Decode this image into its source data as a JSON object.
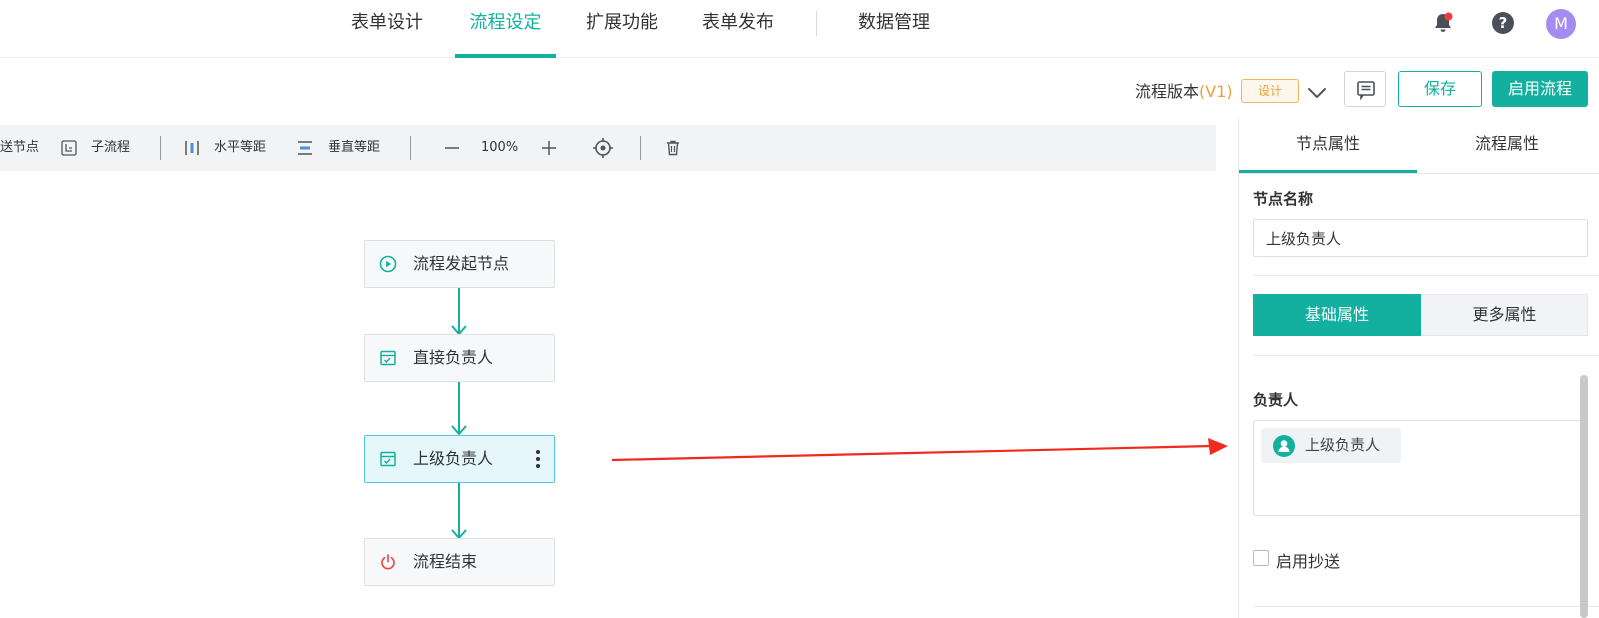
{
  "top_nav": {
    "tabs": [
      {
        "label": "表单设计"
      },
      {
        "label": "流程设定",
        "active": true
      },
      {
        "label": "扩展功能"
      },
      {
        "label": "表单发布"
      },
      {
        "label": "数据管理"
      }
    ],
    "icons": [
      "bell-icon",
      "help-icon"
    ],
    "avatar_letter": "M"
  },
  "version_bar": {
    "label": "流程版本",
    "version": "(V1)",
    "status_badge": "设计",
    "save_label": "保存",
    "enable_label": "启用流程"
  },
  "toolbar": {
    "items": [
      {
        "label": "送节点"
      },
      {
        "label": "子流程"
      },
      {
        "label": "水平等距"
      },
      {
        "label": "垂直等距"
      }
    ],
    "zoom": "100%"
  },
  "flow": {
    "nodes": [
      {
        "label": "流程发起节点",
        "icon": "play-circle-icon"
      },
      {
        "label": "直接负责人",
        "icon": "approval-form-icon"
      },
      {
        "label": "上级负责人",
        "icon": "approval-form-icon",
        "selected": true
      },
      {
        "label": "流程结束",
        "icon": "power-icon"
      }
    ]
  },
  "panel": {
    "tabs": [
      {
        "label": "节点属性",
        "active": true
      },
      {
        "label": "流程属性"
      }
    ],
    "node_name_title": "节点名称",
    "node_name_value": "上级负责人",
    "segments": [
      {
        "label": "基础属性",
        "active": true
      },
      {
        "label": "更多属性"
      }
    ],
    "owner_title": "负责人",
    "owner_chip": "上级负责人",
    "cc_label": "启用抄送"
  },
  "colors": {
    "accent": "#13b0a0",
    "badge_orange": "#e6a23c",
    "annotation_arrow": "#f22a1e",
    "end_red": "#e94b4b",
    "selected_border": "#55c2e8"
  }
}
